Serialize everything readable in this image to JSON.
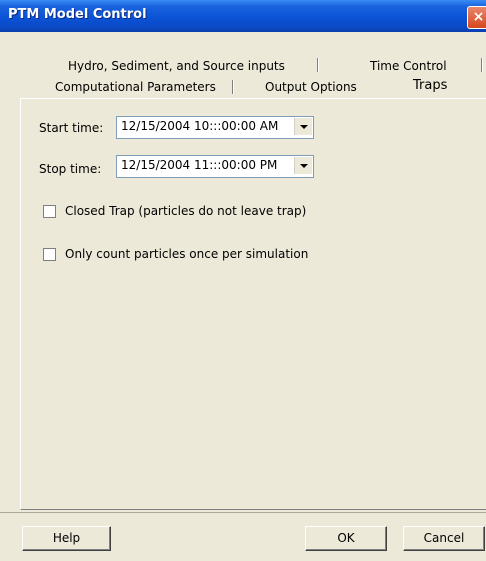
{
  "window": {
    "title": "PTM Model Control",
    "close_glyph": "×"
  },
  "tabs": {
    "back_row": [
      "Hydro, Sediment, and Source inputs",
      "Time Control"
    ],
    "front_row": [
      "Computational Parameters",
      "Output Options",
      "Traps"
    ],
    "active": "Traps"
  },
  "traps": {
    "start_label": "Start time:",
    "start_value": "12/15/2004  10:::00:00 AM",
    "stop_label": "Stop time:",
    "stop_value": "12/15/2004  11:::00:00 PM",
    "closed_trap_label": "Closed Trap (particles do not leave trap)",
    "closed_trap_checked": false,
    "count_once_label": "Only count particles once per simulation",
    "count_once_checked": false
  },
  "buttons": {
    "help": "Help",
    "ok": "OK",
    "cancel": "Cancel"
  },
  "icons": [
    "close-icon",
    "chevron-down-icon"
  ]
}
